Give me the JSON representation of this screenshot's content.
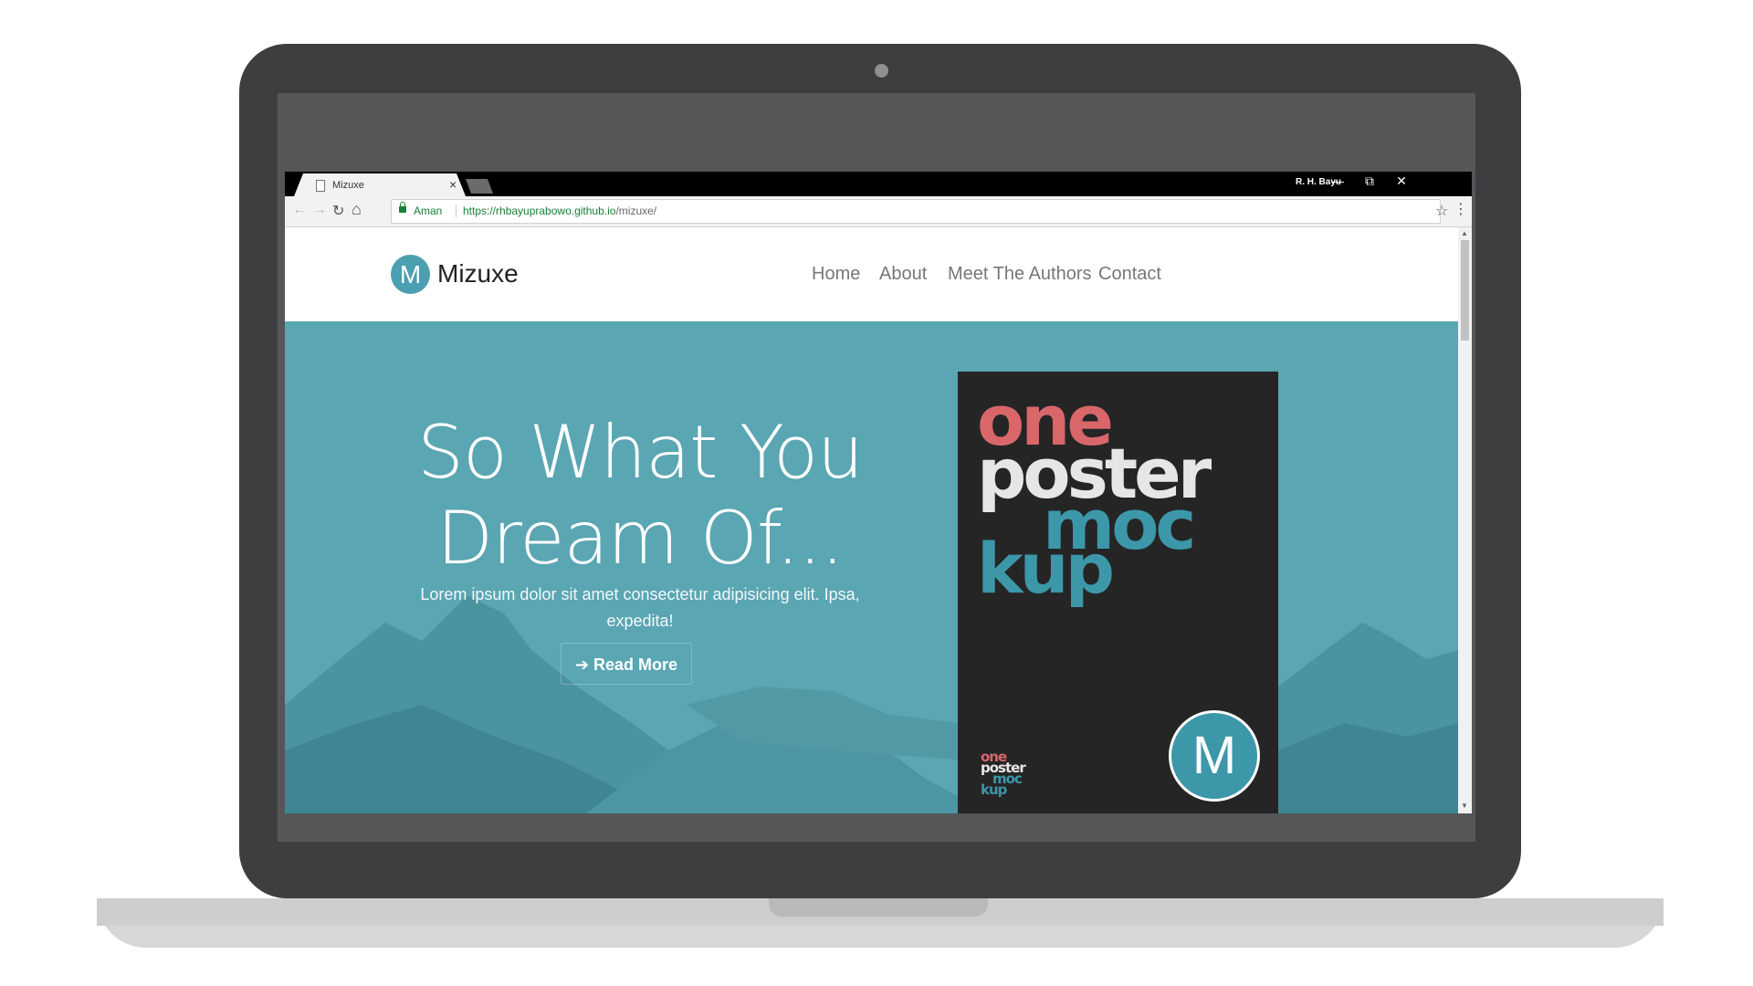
{
  "browser": {
    "tab_title": "Mizuxe",
    "tab_close": "×",
    "user_name": "R. H. Bayu",
    "window_controls": {
      "minimize": "—",
      "restore": "⧉",
      "close": "✕"
    },
    "toolbar": {
      "back": "←",
      "forward": "→",
      "reload": "↻",
      "home": "⌂",
      "star": "☆",
      "menu": "⋮"
    },
    "secure_label": "Aman",
    "url_host": "https://rhbayuprabowo.github.io",
    "url_path": "/mizuxe/"
  },
  "site": {
    "logo_letter": "M",
    "brand": "Mizuxe",
    "nav": [
      {
        "label": "Home"
      },
      {
        "label": "About"
      },
      {
        "label": "Meet The Authors"
      },
      {
        "label": "Contact"
      }
    ]
  },
  "hero": {
    "title_line1": "So What You",
    "title_line2": "Dream Of...",
    "text": "Lorem ipsum dolor sit amet consectetur adipisicing elit. Ipsa, expedita!",
    "button_icon": "➔",
    "button_label": "Read More",
    "background_color": "#5aa6b3"
  },
  "poster": {
    "words": [
      "one",
      "poster",
      "moc",
      "kup"
    ],
    "colors": {
      "one": "#d9676a",
      "poster": "#e6e6e6",
      "moc": "#3c97a9",
      "kup": "#3c97a9"
    },
    "logo_letter": "M"
  }
}
